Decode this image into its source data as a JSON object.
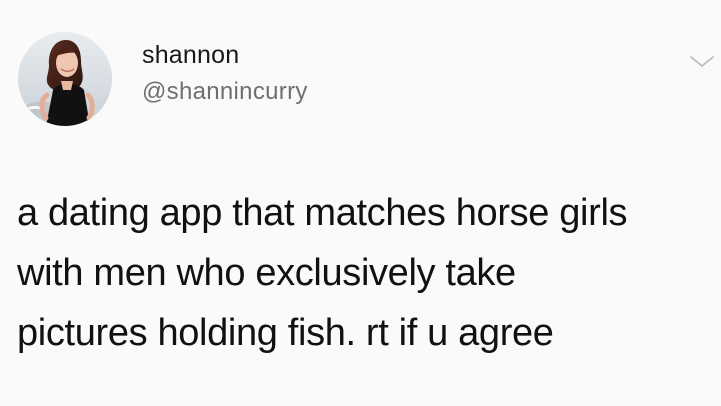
{
  "tweet": {
    "author": {
      "display_name": "shannon",
      "handle": "@shannincurry"
    },
    "text_lines": [
      "a dating app that matches horse girls",
      "with men who exclusively take",
      "pictures holding fish. rt if u agree"
    ]
  },
  "icons": {
    "avatar": "profile-photo",
    "menu": "chevron-down-icon"
  },
  "colors": {
    "background": "#fafafa",
    "text": "#111111",
    "handle": "#6f6f6f",
    "chevron": "#b8b8b8"
  }
}
